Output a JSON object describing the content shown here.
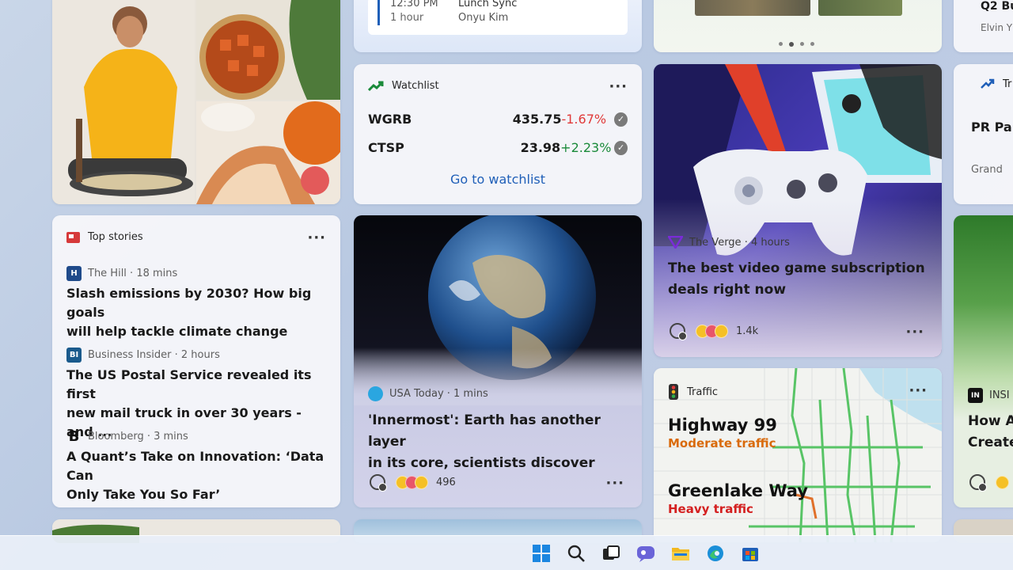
{
  "top_card": {
    "time": "12:30 PM",
    "event": "Lunch Sync",
    "duration": "1 hour",
    "person": "Onyu Kim"
  },
  "right_top_card": {
    "line1": "Q2 Bu",
    "line2": "Elvin Y"
  },
  "right_trend_card": {
    "label": "Tr",
    "headline": "PR Pa",
    "sub": "Grand"
  },
  "watchlist": {
    "title": "Watchlist",
    "more": "···",
    "stocks": [
      {
        "symbol": "WGRB",
        "price": "435.75",
        "change": "-1.67%",
        "direction": "down"
      },
      {
        "symbol": "CTSP",
        "price": "23.98",
        "change": "+2.23%",
        "direction": "up"
      }
    ],
    "link": "Go to watchlist",
    "colors": {
      "down": "#e03a3a",
      "up": "#1a8a3a",
      "link": "#1f5fb8"
    }
  },
  "top_stories": {
    "title": "Top stories",
    "more": "···",
    "items": [
      {
        "logo": "H",
        "logo_color": "#1f4a8a",
        "source": "The Hill · 18 mins",
        "headline_l1": "Slash emissions by 2030? How big goals",
        "headline_l2": "will help tackle climate change"
      },
      {
        "logo": "BI",
        "logo_color": "#1a5a8c",
        "source": "Business Insider · 2 hours",
        "headline_l1": "The US Postal Service revealed its first",
        "headline_l2": "new mail truck in over 30 years - and ..."
      },
      {
        "logo": "B",
        "logo_color": "#111111",
        "source": "Bloomberg · 3 mins",
        "headline_l1": "A Quant’s Take on Innovation: ‘Data Can",
        "headline_l2": "Only Take You So Far’"
      }
    ]
  },
  "earth_card": {
    "source": "USA Today · 1 mins",
    "headline_l1": "'Innermost': Earth has another layer",
    "headline_l2": "in its core, scientists discover",
    "reactions": "496",
    "more": "···"
  },
  "verge_card": {
    "source": "The Verge · 4 hours",
    "headline_l1": "The best video game subscription",
    "headline_l2": "deals right now",
    "reactions": "1.4k",
    "more": "···"
  },
  "traffic": {
    "title": "Traffic",
    "more": "···",
    "roads": [
      {
        "name": "Highway 99",
        "status": "Moderate traffic",
        "color": "#d96a0b"
      },
      {
        "name": "Greenlake Way",
        "status": "Heavy traffic",
        "color": "#d42020"
      }
    ]
  },
  "insider_card": {
    "source": "INSI",
    "headline_l1": "How A",
    "headline_l2": "Create"
  },
  "taskbar": {
    "icons": [
      "windows-start-icon",
      "search-icon",
      "task-view-icon",
      "chat-icon",
      "file-explorer-icon",
      "edge-browser-icon",
      "store-icon"
    ]
  }
}
